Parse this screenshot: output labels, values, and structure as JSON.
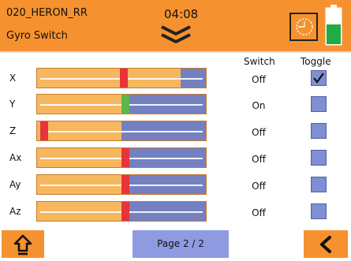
{
  "header": {
    "model_name": "020_HERON_RR",
    "screen_title": "Gyro Switch",
    "timer": "04:08",
    "battery_level": 0.55,
    "battery_color": "#22aa44"
  },
  "columns": {
    "switch": "Switch",
    "toggle": "Toggle"
  },
  "rows": [
    {
      "label": "X",
      "switch": "Off",
      "toggle": true,
      "position": 0.49,
      "fill": 0.85,
      "marker_color": "#e8333a"
    },
    {
      "label": "Y",
      "switch": "On",
      "toggle": false,
      "position": 0.5,
      "fill": 0.5,
      "marker_color": "#5cb84a"
    },
    {
      "label": "Z",
      "switch": "Off",
      "toggle": false,
      "position": 0.02,
      "fill": 0.5,
      "marker_color": "#e8333a"
    },
    {
      "label": "Ax",
      "switch": "Off",
      "toggle": false,
      "position": 0.5,
      "fill": 0.5,
      "marker_color": "#e8333a"
    },
    {
      "label": "Ay",
      "switch": "Off",
      "toggle": false,
      "position": 0.5,
      "fill": 0.5,
      "marker_color": "#e8333a"
    },
    {
      "label": "Az",
      "switch": "Off",
      "toggle": false,
      "position": 0.5,
      "fill": 0.5,
      "marker_color": "#e8333a"
    }
  ],
  "footer": {
    "page_label": "Page 2 / 2",
    "home_icon": "home-icon",
    "back_icon": "back-chevron-icon"
  },
  "colors": {
    "accent": "#f5922f",
    "slider_bg": "#7480c2",
    "slider_fill": "#f6b75e",
    "page_button": "#8f9be0"
  }
}
